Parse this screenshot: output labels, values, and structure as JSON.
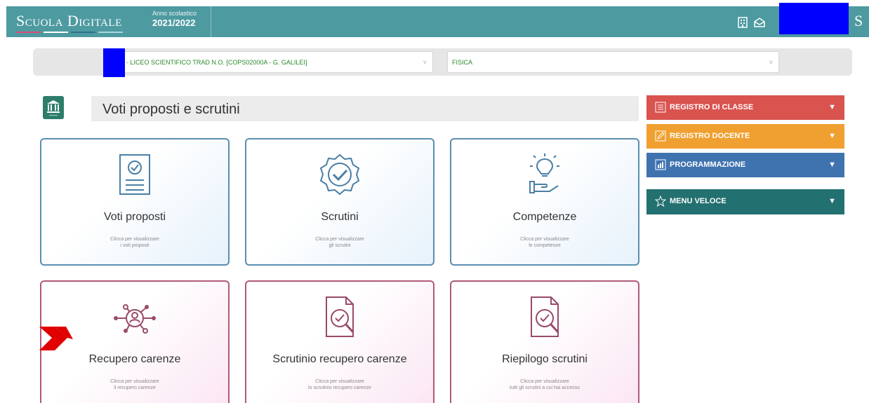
{
  "header": {
    "brand": "Scuola Digitale",
    "brand_colors": [
      "#e04a7a",
      "#ffffff",
      "#2e6f8e",
      "#a8d6d9"
    ],
    "year_label": "Anno scolastico",
    "year_value": "2021/2022",
    "icons": [
      "building-icon",
      "mail-icon"
    ],
    "cut_text": "S"
  },
  "selectors": {
    "school": "- LICEO SCIENTIFICO TRAD N.O. [COPS02000A - G. GALILEI]",
    "subject": "FISICA",
    "chevron": "˅"
  },
  "title": {
    "text": "Voti proposti e scrutini"
  },
  "cards": [
    {
      "title": "Voti proposti",
      "desc1": "Clicca per visualizzare",
      "desc2": "i voti proposti",
      "icon": "document-check-icon"
    },
    {
      "title": "Scrutini",
      "desc1": "Clicca per visualizzare",
      "desc2": "gli scrutini",
      "icon": "badge-check-icon"
    },
    {
      "title": "Competenze",
      "desc1": "Clicca per visualizzare",
      "desc2": "le competenze",
      "icon": "lightbulb-hand-icon"
    },
    {
      "title": "Recupero carenze",
      "desc1": "Clicca per visualizzare",
      "desc2": "il recupero carenze",
      "icon": "network-person-icon"
    },
    {
      "title": "Scrutinio recupero carenze",
      "desc1": "Clicca per visualizzare",
      "desc2": "lo scrutinio recupero carenze",
      "icon": "document-search-icon"
    },
    {
      "title": "Riepilogo scrutini",
      "desc1": "Clicca per visualizzare",
      "desc2": "tutti gli scrutini a cui hai accesso",
      "icon": "document-search-icon"
    }
  ],
  "menu": [
    {
      "label": "REGISTRO DI CLASSE",
      "color": "#d9534f"
    },
    {
      "label": "REGISTRO DOCENTE",
      "color": "#f0a030"
    },
    {
      "label": "PROGRAMMAZIONE",
      "color": "#3f73b0"
    },
    {
      "label": "MENU VELOCE",
      "color": "#237070"
    }
  ],
  "caret": "▼"
}
